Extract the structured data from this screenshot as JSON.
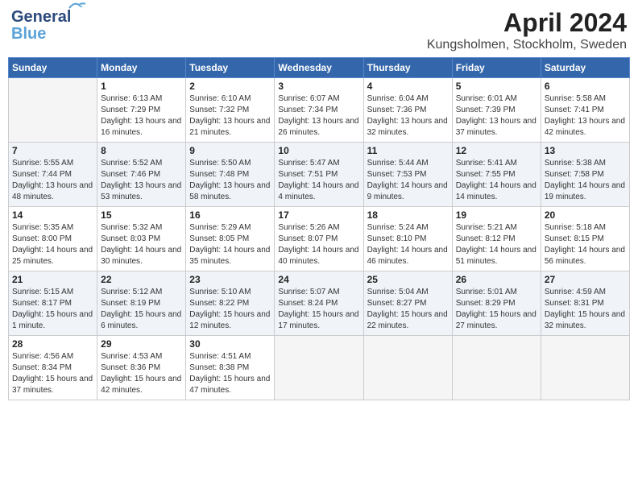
{
  "header": {
    "logo_line1": "General",
    "logo_line2": "Blue",
    "month_title": "April 2024",
    "location": "Kungsholmen, Stockholm, Sweden"
  },
  "weekdays": [
    "Sunday",
    "Monday",
    "Tuesday",
    "Wednesday",
    "Thursday",
    "Friday",
    "Saturday"
  ],
  "weeks": [
    [
      {
        "day": "",
        "sunrise": "",
        "sunset": "",
        "daylight": "",
        "empty": true
      },
      {
        "day": "1",
        "sunrise": "Sunrise: 6:13 AM",
        "sunset": "Sunset: 7:29 PM",
        "daylight": "Daylight: 13 hours and 16 minutes.",
        "empty": false
      },
      {
        "day": "2",
        "sunrise": "Sunrise: 6:10 AM",
        "sunset": "Sunset: 7:32 PM",
        "daylight": "Daylight: 13 hours and 21 minutes.",
        "empty": false
      },
      {
        "day": "3",
        "sunrise": "Sunrise: 6:07 AM",
        "sunset": "Sunset: 7:34 PM",
        "daylight": "Daylight: 13 hours and 26 minutes.",
        "empty": false
      },
      {
        "day": "4",
        "sunrise": "Sunrise: 6:04 AM",
        "sunset": "Sunset: 7:36 PM",
        "daylight": "Daylight: 13 hours and 32 minutes.",
        "empty": false
      },
      {
        "day": "5",
        "sunrise": "Sunrise: 6:01 AM",
        "sunset": "Sunset: 7:39 PM",
        "daylight": "Daylight: 13 hours and 37 minutes.",
        "empty": false
      },
      {
        "day": "6",
        "sunrise": "Sunrise: 5:58 AM",
        "sunset": "Sunset: 7:41 PM",
        "daylight": "Daylight: 13 hours and 42 minutes.",
        "empty": false
      }
    ],
    [
      {
        "day": "7",
        "sunrise": "Sunrise: 5:55 AM",
        "sunset": "Sunset: 7:44 PM",
        "daylight": "Daylight: 13 hours and 48 minutes.",
        "empty": false
      },
      {
        "day": "8",
        "sunrise": "Sunrise: 5:52 AM",
        "sunset": "Sunset: 7:46 PM",
        "daylight": "Daylight: 13 hours and 53 minutes.",
        "empty": false
      },
      {
        "day": "9",
        "sunrise": "Sunrise: 5:50 AM",
        "sunset": "Sunset: 7:48 PM",
        "daylight": "Daylight: 13 hours and 58 minutes.",
        "empty": false
      },
      {
        "day": "10",
        "sunrise": "Sunrise: 5:47 AM",
        "sunset": "Sunset: 7:51 PM",
        "daylight": "Daylight: 14 hours and 4 minutes.",
        "empty": false
      },
      {
        "day": "11",
        "sunrise": "Sunrise: 5:44 AM",
        "sunset": "Sunset: 7:53 PM",
        "daylight": "Daylight: 14 hours and 9 minutes.",
        "empty": false
      },
      {
        "day": "12",
        "sunrise": "Sunrise: 5:41 AM",
        "sunset": "Sunset: 7:55 PM",
        "daylight": "Daylight: 14 hours and 14 minutes.",
        "empty": false
      },
      {
        "day": "13",
        "sunrise": "Sunrise: 5:38 AM",
        "sunset": "Sunset: 7:58 PM",
        "daylight": "Daylight: 14 hours and 19 minutes.",
        "empty": false
      }
    ],
    [
      {
        "day": "14",
        "sunrise": "Sunrise: 5:35 AM",
        "sunset": "Sunset: 8:00 PM",
        "daylight": "Daylight: 14 hours and 25 minutes.",
        "empty": false
      },
      {
        "day": "15",
        "sunrise": "Sunrise: 5:32 AM",
        "sunset": "Sunset: 8:03 PM",
        "daylight": "Daylight: 14 hours and 30 minutes.",
        "empty": false
      },
      {
        "day": "16",
        "sunrise": "Sunrise: 5:29 AM",
        "sunset": "Sunset: 8:05 PM",
        "daylight": "Daylight: 14 hours and 35 minutes.",
        "empty": false
      },
      {
        "day": "17",
        "sunrise": "Sunrise: 5:26 AM",
        "sunset": "Sunset: 8:07 PM",
        "daylight": "Daylight: 14 hours and 40 minutes.",
        "empty": false
      },
      {
        "day": "18",
        "sunrise": "Sunrise: 5:24 AM",
        "sunset": "Sunset: 8:10 PM",
        "daylight": "Daylight: 14 hours and 46 minutes.",
        "empty": false
      },
      {
        "day": "19",
        "sunrise": "Sunrise: 5:21 AM",
        "sunset": "Sunset: 8:12 PM",
        "daylight": "Daylight: 14 hours and 51 minutes.",
        "empty": false
      },
      {
        "day": "20",
        "sunrise": "Sunrise: 5:18 AM",
        "sunset": "Sunset: 8:15 PM",
        "daylight": "Daylight: 14 hours and 56 minutes.",
        "empty": false
      }
    ],
    [
      {
        "day": "21",
        "sunrise": "Sunrise: 5:15 AM",
        "sunset": "Sunset: 8:17 PM",
        "daylight": "Daylight: 15 hours and 1 minute.",
        "empty": false
      },
      {
        "day": "22",
        "sunrise": "Sunrise: 5:12 AM",
        "sunset": "Sunset: 8:19 PM",
        "daylight": "Daylight: 15 hours and 6 minutes.",
        "empty": false
      },
      {
        "day": "23",
        "sunrise": "Sunrise: 5:10 AM",
        "sunset": "Sunset: 8:22 PM",
        "daylight": "Daylight: 15 hours and 12 minutes.",
        "empty": false
      },
      {
        "day": "24",
        "sunrise": "Sunrise: 5:07 AM",
        "sunset": "Sunset: 8:24 PM",
        "daylight": "Daylight: 15 hours and 17 minutes.",
        "empty": false
      },
      {
        "day": "25",
        "sunrise": "Sunrise: 5:04 AM",
        "sunset": "Sunset: 8:27 PM",
        "daylight": "Daylight: 15 hours and 22 minutes.",
        "empty": false
      },
      {
        "day": "26",
        "sunrise": "Sunrise: 5:01 AM",
        "sunset": "Sunset: 8:29 PM",
        "daylight": "Daylight: 15 hours and 27 minutes.",
        "empty": false
      },
      {
        "day": "27",
        "sunrise": "Sunrise: 4:59 AM",
        "sunset": "Sunset: 8:31 PM",
        "daylight": "Daylight: 15 hours and 32 minutes.",
        "empty": false
      }
    ],
    [
      {
        "day": "28",
        "sunrise": "Sunrise: 4:56 AM",
        "sunset": "Sunset: 8:34 PM",
        "daylight": "Daylight: 15 hours and 37 minutes.",
        "empty": false
      },
      {
        "day": "29",
        "sunrise": "Sunrise: 4:53 AM",
        "sunset": "Sunset: 8:36 PM",
        "daylight": "Daylight: 15 hours and 42 minutes.",
        "empty": false
      },
      {
        "day": "30",
        "sunrise": "Sunrise: 4:51 AM",
        "sunset": "Sunset: 8:38 PM",
        "daylight": "Daylight: 15 hours and 47 minutes.",
        "empty": false
      },
      {
        "day": "",
        "sunrise": "",
        "sunset": "",
        "daylight": "",
        "empty": true
      },
      {
        "day": "",
        "sunrise": "",
        "sunset": "",
        "daylight": "",
        "empty": true
      },
      {
        "day": "",
        "sunrise": "",
        "sunset": "",
        "daylight": "",
        "empty": true
      },
      {
        "day": "",
        "sunrise": "",
        "sunset": "",
        "daylight": "",
        "empty": true
      }
    ]
  ]
}
